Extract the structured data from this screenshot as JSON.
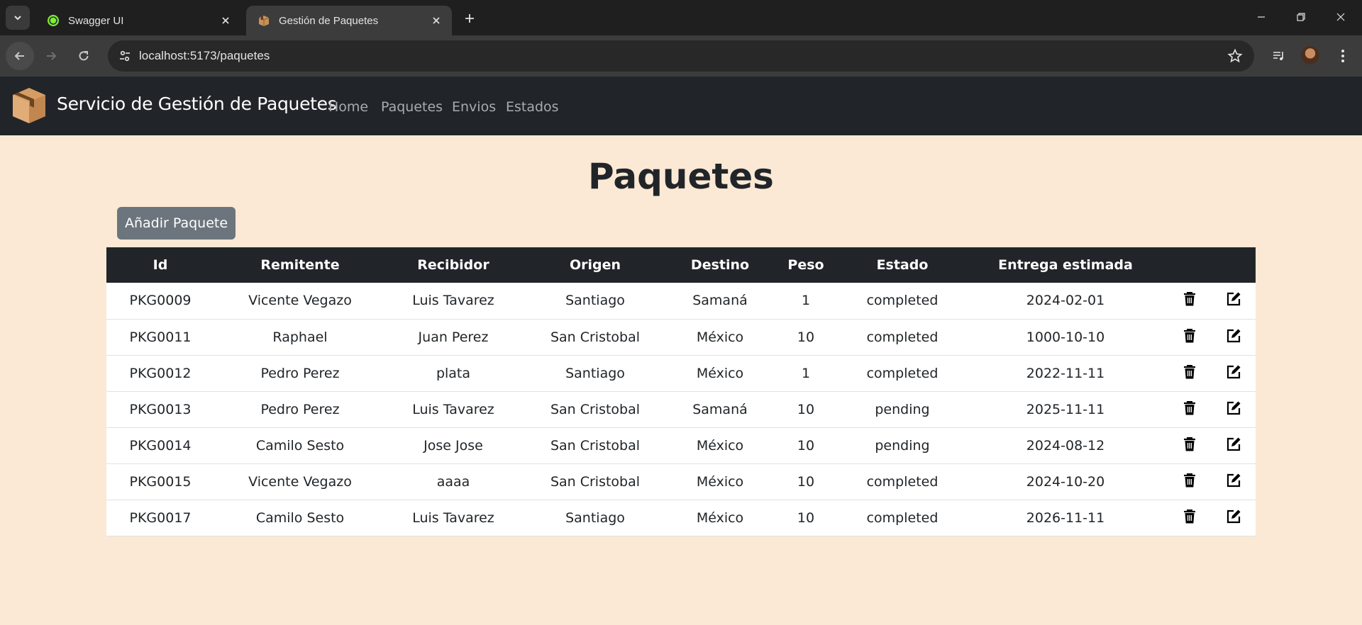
{
  "browser": {
    "tabs": [
      {
        "title": "Swagger UI",
        "active": false,
        "favicon": "swagger-icon"
      },
      {
        "title": "Gestión de Paquetes",
        "active": true,
        "favicon": "package-box-icon"
      }
    ],
    "url": "localhost:5173/paquetes"
  },
  "app": {
    "brand": "Servicio de Gestión de Paquetes",
    "nav": [
      "Home",
      "Paquetes",
      "Envios",
      "Estados"
    ]
  },
  "page": {
    "title": "Paquetes",
    "add_button": "Añadir Paquete"
  },
  "table": {
    "headers": [
      "Id",
      "Remitente",
      "Recibidor",
      "Origen",
      "Destino",
      "Peso",
      "Estado",
      "Entrega estimada"
    ],
    "rows": [
      [
        "PKG0009",
        "Vicente Vegazo",
        "Luis Tavarez",
        "Santiago",
        "Samaná",
        "1",
        "completed",
        "2024-02-01"
      ],
      [
        "PKG0011",
        "Raphael",
        "Juan Perez",
        "San Cristobal",
        "México",
        "10",
        "completed",
        "1000-10-10"
      ],
      [
        "PKG0012",
        "Pedro Perez",
        "plata",
        "Santiago",
        "México",
        "1",
        "completed",
        "2022-11-11"
      ],
      [
        "PKG0013",
        "Pedro Perez",
        "Luis Tavarez",
        "San Cristobal",
        "Samaná",
        "10",
        "pending",
        "2025-11-11"
      ],
      [
        "PKG0014",
        "Camilo Sesto",
        "Jose Jose",
        "San Cristobal",
        "México",
        "10",
        "pending",
        "2024-08-12"
      ],
      [
        "PKG0015",
        "Vicente Vegazo",
        "aaaa",
        "San Cristobal",
        "México",
        "10",
        "completed",
        "2024-10-20"
      ],
      [
        "PKG0017",
        "Camilo Sesto",
        "Luis Tavarez",
        "Santiago",
        "México",
        "10",
        "completed",
        "2026-11-11"
      ]
    ]
  },
  "colors": {
    "page_bg": "#fbe9d5",
    "navbar_bg": "#212529",
    "button_bg": "#6c757d"
  }
}
